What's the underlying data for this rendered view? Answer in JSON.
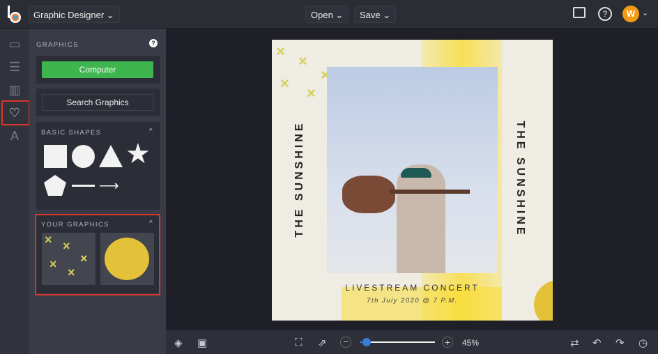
{
  "header": {
    "app_menu": "Graphic Designer",
    "open": "Open",
    "save": "Save",
    "avatar_initial": "W"
  },
  "panel": {
    "title": "GRAPHICS",
    "computer": "Computer",
    "search": "Search Graphics",
    "basic_shapes": "BASIC SHAPES",
    "your_graphics": "YOUR GRAPHICS"
  },
  "design": {
    "side_text_left": "THE SUNSHINE",
    "side_text_right": "THE SUNSHINE",
    "headline": "LIVESTREAM CONCERT",
    "date": "7th July 2020 @ 7 P.M."
  },
  "footer": {
    "zoom": "45%",
    "zoom_slider_fraction": 0.08
  },
  "colors": {
    "accent_green": "#3eb54e",
    "highlight_red": "#d8362a",
    "avatar": "#f39c12",
    "design_yellow": "#e3c23a"
  }
}
